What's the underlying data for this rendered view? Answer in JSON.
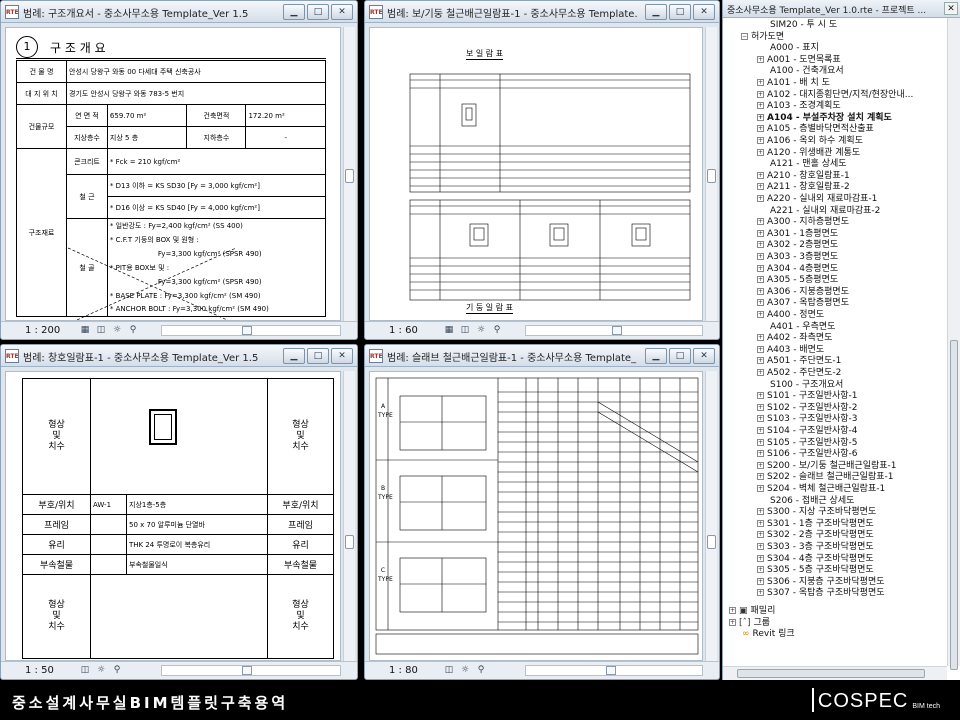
{
  "windows": {
    "w1": {
      "title": "범례: 구조개요서 - 중소사무소용 Template_Ver 1.5",
      "scale": "1 : 200"
    },
    "w2": {
      "title": "범례: 보/기둥 철근배근일람표-1 - 중소사무소용 Template...",
      "scale": "1 : 60"
    },
    "w3": {
      "title": "범례: 창호일람표-1 - 중소사무소용 Template_Ver 1.5",
      "scale": "1 : 50"
    },
    "w4": {
      "title": "범례: 슬래브 철근배근일람표-1 - 중소사무소용 Template_...",
      "scale": "1 : 80"
    },
    "btn_min": "▁",
    "btn_max": "□",
    "btn_close": "✕",
    "rte": "RTE"
  },
  "sheet1": {
    "number": "1",
    "heading": "구 조 개 요",
    "rows": [
      [
        "건 물 명",
        "",
        "안성시 당왕구 와동 00 다세대 주택 신축공사"
      ],
      [
        "대 지 위 치",
        "",
        "경기도 안성시 당왕구 와동 783-5 번지"
      ],
      [
        "건물규모",
        "연 면 적",
        "659.70 m²",
        "건축면적",
        "172.20 m²"
      ],
      [
        "",
        "지상층수",
        "지상 5 층",
        "지하층수",
        "-"
      ],
      [
        "구조재료",
        "콘크리트",
        "* Fck = 210 kgf/cm²"
      ],
      [
        "",
        "철 근",
        "* D13 이하 = KS SD30 [Fy = 3,000 kgf/cm²]"
      ],
      [
        "",
        "",
        "* D16 이상 = KS SD40 [Fy = 4,000 kgf/cm²]"
      ],
      [
        "",
        "철 골",
        "* 일반강도 : Fy=2,400 kgf/cm² (SS 400)"
      ],
      [
        "",
        "",
        "* C.F.T 기둥의 BOX 및 원형 :"
      ],
      [
        "",
        "",
        "Fy=3,300 kgf/cm² (SPSR 490)"
      ],
      [
        "",
        "",
        "* PIT용 BOX보 및 :"
      ],
      [
        "",
        "",
        "Fy=3,300 kgf/cm² (SPSR 490)"
      ],
      [
        "",
        "",
        "* BASE PLATE : Fy=3,300 kgf/cm² (SM 490)"
      ],
      [
        "",
        "",
        "* ANCHOR BOLT : Fy=3,300 kgf/cm² (SM 490)"
      ]
    ]
  },
  "sheet2": {
    "beam_title": "보 일 람 표",
    "column_title": "기 둥 일 람 표"
  },
  "sheet3": {
    "label_shape": "형상\n및\n치수",
    "rows": [
      [
        "부호/위치",
        "AW-1",
        "지상1층-5층",
        "부호/위치"
      ],
      [
        "프레임",
        "",
        "50 x 70 알루미늄 단열바",
        "프레임"
      ],
      [
        "유리",
        "",
        "THK 24 투명로이 복층유리",
        "유리"
      ],
      [
        "부속철물",
        "",
        "부속철물일식",
        "부속철물"
      ]
    ]
  },
  "sheet4": {
    "type_a": "A TYPE",
    "type_b": "B TYPE",
    "type_c": "C TYPE"
  },
  "browser": {
    "title": "중소사무소용 Template_Ver 1.0.rte - 프로젝트 ...",
    "close": "✕",
    "items": [
      {
        "t": "SIM20 - 투 시 도",
        "lvl": 2
      },
      {
        "t": "허가도면",
        "lvl": 1,
        "open": true
      },
      {
        "t": "A000 - 표지",
        "lvl": 2
      },
      {
        "t": "A001 - 도면목록표",
        "lvl": 2,
        "box": true
      },
      {
        "t": "A100 - 건축개요서",
        "lvl": 2
      },
      {
        "t": "A101 - 배 치 도",
        "lvl": 2,
        "box": true
      },
      {
        "t": "A102 - 대지종횡단면/지적/현장안내...",
        "lvl": 2,
        "box": true
      },
      {
        "t": "A103 - 조경계획도",
        "lvl": 2,
        "box": true
      },
      {
        "t": "A104 - 부설주차장 설치 계획도",
        "lvl": 2,
        "box": true,
        "bold": true
      },
      {
        "t": "A105 - 층별바닥면적산출표",
        "lvl": 2,
        "box": true
      },
      {
        "t": "A106 - 옥외 하수 계획도",
        "lvl": 2,
        "box": true
      },
      {
        "t": "A120 - 위생배관 계통도",
        "lvl": 2,
        "box": true
      },
      {
        "t": "A121 - 맨홀 상세도",
        "lvl": 2
      },
      {
        "t": "A210 - 창호일람표-1",
        "lvl": 2,
        "box": true
      },
      {
        "t": "A211 - 창호일람표-2",
        "lvl": 2,
        "box": true
      },
      {
        "t": "A220 - 실내외 재료마감표-1",
        "lvl": 2,
        "box": true
      },
      {
        "t": "A221 - 실내외 재료마감표-2",
        "lvl": 2
      },
      {
        "t": "A300 - 지하층평면도",
        "lvl": 2,
        "box": true
      },
      {
        "t": "A301 - 1층평면도",
        "lvl": 2,
        "box": true
      },
      {
        "t": "A302 - 2층평면도",
        "lvl": 2,
        "box": true
      },
      {
        "t": "A303 - 3층평면도",
        "lvl": 2,
        "box": true
      },
      {
        "t": "A304 - 4층평면도",
        "lvl": 2,
        "box": true
      },
      {
        "t": "A305 - 5층평면도",
        "lvl": 2,
        "box": true
      },
      {
        "t": "A306 - 지붕층평면도",
        "lvl": 2,
        "box": true
      },
      {
        "t": "A307 - 옥탑층평면도",
        "lvl": 2,
        "box": true
      },
      {
        "t": "A400 - 정면도",
        "lvl": 2,
        "box": true
      },
      {
        "t": "A401 - 우측면도",
        "lvl": 2
      },
      {
        "t": "A402 - 좌측면도",
        "lvl": 2,
        "box": true
      },
      {
        "t": "A403 - 배면도",
        "lvl": 2,
        "box": true
      },
      {
        "t": "A501 - 주단면도-1",
        "lvl": 2,
        "box": true
      },
      {
        "t": "A502 - 주단면도-2",
        "lvl": 2,
        "box": true
      },
      {
        "t": "S100 - 구조개요서",
        "lvl": 2
      },
      {
        "t": "S101 - 구조일반사항-1",
        "lvl": 2,
        "box": true
      },
      {
        "t": "S102 - 구조일반사항-2",
        "lvl": 2,
        "box": true
      },
      {
        "t": "S103 - 구조일반사항-3",
        "lvl": 2,
        "box": true
      },
      {
        "t": "S104 - 구조일반사항-4",
        "lvl": 2,
        "box": true
      },
      {
        "t": "S105 - 구조일반사항-5",
        "lvl": 2,
        "box": true
      },
      {
        "t": "S106 - 구조일반사항-6",
        "lvl": 2,
        "box": true
      },
      {
        "t": "S200 - 보/기둥 철근배근일람표-1",
        "lvl": 2,
        "box": true
      },
      {
        "t": "S202 - 슬래브 철근배근일람표-1",
        "lvl": 2,
        "box": true
      },
      {
        "t": "S204 - 벽체 철근배근일람표-1",
        "lvl": 2,
        "box": true
      },
      {
        "t": "S206 - 접배근 상세도",
        "lvl": 2
      },
      {
        "t": "S300 - 지상 구조바닥평면도",
        "lvl": 2,
        "box": true
      },
      {
        "t": "S301 - 1층 구조바닥평면도",
        "lvl": 2,
        "box": true
      },
      {
        "t": "S302 - 2층 구조바닥평면도",
        "lvl": 2,
        "box": true
      },
      {
        "t": "S303 - 3층 구조바닥평면도",
        "lvl": 2,
        "box": true
      },
      {
        "t": "S304 - 4층 구조바닥평면도",
        "lvl": 2,
        "box": true
      },
      {
        "t": "S305 - 5층 구조바닥평면도",
        "lvl": 2,
        "box": true
      },
      {
        "t": "S306 - 지붕층 구조바닥평면도",
        "lvl": 2,
        "box": true
      },
      {
        "t": "S307 - 옥탑층 구조바닥평면도",
        "lvl": 2,
        "box": true
      },
      {
        "t": "패밀리",
        "lvl": 0,
        "box": true,
        "icon": "▣"
      },
      {
        "t": "그룹",
        "lvl": 0,
        "box": true,
        "icon": "[ˆ]"
      },
      {
        "t": "Revit 링크",
        "lvl": 0,
        "icon": "∞"
      }
    ]
  },
  "footer": {
    "caption": "중소설계사무실BIM템플릿구축용역",
    "logo": "COSPEC",
    "logo_sub": "BIM tech"
  }
}
